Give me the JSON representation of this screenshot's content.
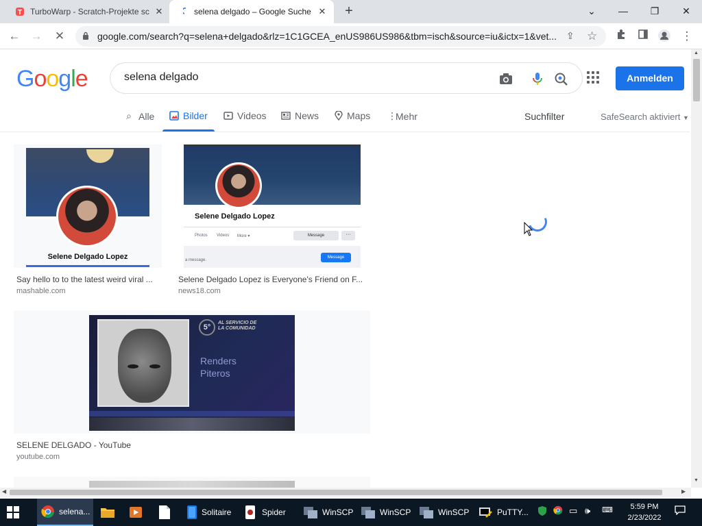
{
  "browser": {
    "tabs": [
      {
        "title": "TurboWarp - Scratch-Projekte sc",
        "active": false
      },
      {
        "title": "selena delgado – Google Suche",
        "active": true
      }
    ],
    "url": "google.com/search?q=selena+delgado&rlz=1C1GCEA_enUS986US986&tbm=isch&source=iu&ictx=1&vet..."
  },
  "google": {
    "logo": "Google",
    "query": "selena delgado",
    "signin_label": "Anmelden",
    "nav": {
      "all": "Alle",
      "images": "Bilder",
      "videos": "Videos",
      "news": "News",
      "maps": "Maps",
      "more": "Mehr"
    },
    "search_filter": "Suchfilter",
    "safesearch": "SafeSearch aktiviert"
  },
  "results": [
    {
      "title": "Say hello to to the latest weird viral ...",
      "domain": "mashable.com",
      "image_text": "Selene Delgado Lopez"
    },
    {
      "title": "Selene Delgado Lopez is Everyone's Friend on F...",
      "domain": "news18.com",
      "image_text": "Selene Delgado Lopez",
      "image_ui": {
        "photos": "Photos",
        "videos": "Videos",
        "more": "More ▾",
        "message": "Message",
        "dots": "···",
        "type_message": "a message.",
        "message_btn": "Message"
      }
    },
    {
      "title": "SELENE DELGADO - YouTube",
      "domain": "youtube.com",
      "image_text": {
        "badge_number": "5°",
        "badge_text": "AL SERVICIO DE LA COMUNIDAD",
        "renders_line1": "Renders",
        "renders_line2": "Piteros"
      }
    }
  ],
  "taskbar": {
    "items": [
      {
        "label": "selena...",
        "icon": "chrome-icon",
        "active": true
      },
      {
        "label": "",
        "icon": "file-explorer-icon"
      },
      {
        "label": "",
        "icon": "media-player-icon"
      },
      {
        "label": "",
        "icon": "notepad-icon"
      },
      {
        "label": "Solitaire",
        "icon": "solitaire-icon"
      },
      {
        "label": "Spider",
        "icon": "spider-solitaire-icon"
      },
      {
        "label": "WinSCP",
        "icon": "winscp-icon"
      },
      {
        "label": "WinSCP",
        "icon": "winscp-icon"
      },
      {
        "label": "WinSCP",
        "icon": "winscp-icon"
      },
      {
        "label": "PuTTY...",
        "icon": "putty-icon"
      }
    ],
    "time": "5:59 PM",
    "date": "2/23/2022"
  },
  "colors": {
    "google_blue": "#4285f4",
    "google_red": "#ea4335",
    "google_yellow": "#fbbc05",
    "google_green": "#34a853",
    "accent": "#1a73e8",
    "taskbar": "#0c1724"
  }
}
